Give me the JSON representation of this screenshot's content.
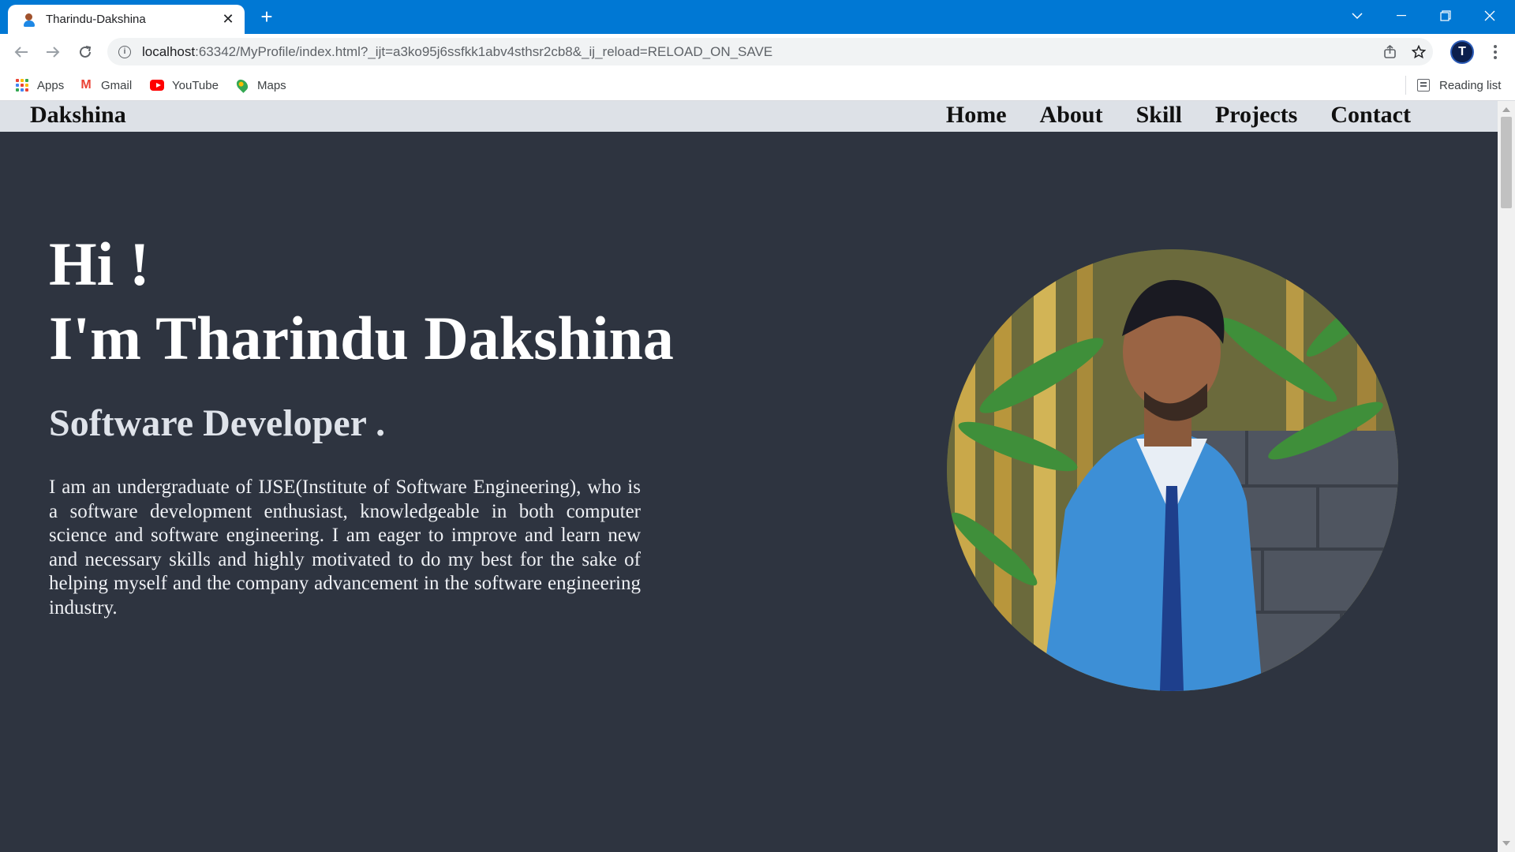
{
  "browser": {
    "tab_title": "Tharindu-Dakshina",
    "tab_close": "✕",
    "new_tab": "+",
    "url_host": "localhost",
    "url_rest": ":63342/MyProfile/index.html?_ijt=a3ko95j6ssfkk1abv4sthsr2cb8&_ij_reload=RELOAD_ON_SAVE",
    "profile_initial": "T",
    "bookmarks": [
      {
        "label": "Apps",
        "icon": "apps-grid-icon"
      },
      {
        "label": "Gmail",
        "icon": "gmail-icon"
      },
      {
        "label": "YouTube",
        "icon": "youtube-icon"
      },
      {
        "label": "Maps",
        "icon": "maps-icon"
      }
    ],
    "reading_list": "Reading list",
    "accent_color": "#0078d4"
  },
  "site": {
    "brand": "Dakshina",
    "nav": [
      "Home",
      "About",
      "Skill",
      "Projects",
      "Contact"
    ],
    "hero": {
      "greeting": "Hi !",
      "name": "I'm Tharindu Dakshina",
      "role": "Software Developer .",
      "bio": "I am an undergraduate of IJSE(Institute of Software Engineering), who is a software development enthusiast, knowledgeable in both computer science and software engineering. I am eager to improve and learn new and necessary skills and highly motivated to do my best for the sake of helping myself and the company advancement in the software engineering industry."
    },
    "background_color": "#2e3440",
    "nav_background": "#dde1e7"
  }
}
